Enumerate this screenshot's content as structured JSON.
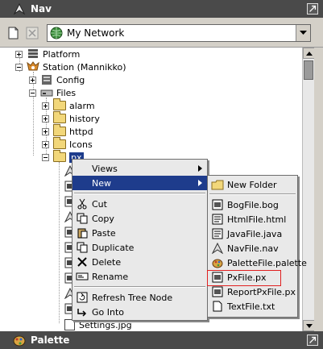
{
  "nav_title": "Nav",
  "toolbar": {
    "location": "My Network"
  },
  "tree": {
    "platform": "Platform",
    "station": "Station (Mannikko)",
    "config": "Config",
    "files": "Files",
    "alarm": "alarm",
    "history": "history",
    "httpd": "httpd",
    "icons": "Icons",
    "px": "px",
    "settings_file": "Settings.jpg"
  },
  "context_menu": {
    "views": "Views",
    "new": "New",
    "cut": "Cut",
    "copy": "Copy",
    "paste": "Paste",
    "duplicate": "Duplicate",
    "delete": "Delete",
    "rename": "Rename",
    "refresh": "Refresh Tree Node",
    "go_into": "Go Into"
  },
  "new_submenu": {
    "new_folder": "New Folder",
    "bog": "BogFile.bog",
    "html": "HtmlFile.html",
    "java": "JavaFile.java",
    "nav": "NavFile.nav",
    "palette": "PaletteFile.palette",
    "px": "PxFile.px",
    "reportpx": "ReportPxFile.px",
    "text": "TextFile.txt"
  },
  "palette_title": "Palette",
  "colors": {
    "highlight": "#1e3c8c",
    "titlebar": "#4a4a4a",
    "red_outline": "#e02020"
  }
}
